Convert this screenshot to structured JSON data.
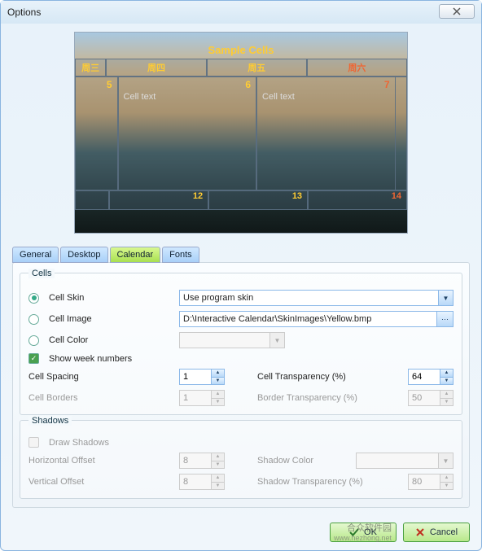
{
  "window": {
    "title": "Options"
  },
  "preview": {
    "title": "Sample Cells",
    "header_days": [
      "周三",
      "周四",
      "周五",
      "周六"
    ],
    "body_cells": [
      {
        "num": "5",
        "text": ""
      },
      {
        "num": "6",
        "text": "Cell text"
      },
      {
        "num": "7",
        "text": "Cell text"
      }
    ],
    "foot_nums": [
      "12",
      "13",
      "14"
    ]
  },
  "tabs": [
    {
      "label": "General"
    },
    {
      "label": "Desktop"
    },
    {
      "label": "Calendar"
    },
    {
      "label": "Fonts"
    }
  ],
  "cells_group": {
    "legend": "Cells",
    "cell_skin_label": "Cell Skin",
    "cell_skin_value": "Use program skin",
    "cell_image_label": "Cell Image",
    "cell_image_path": "D:\\Interactive Calendar\\SkinImages\\Yellow.bmp",
    "cell_color_label": "Cell Color",
    "show_week_label": "Show week numbers",
    "cell_spacing_label": "Cell Spacing",
    "cell_spacing_value": "1",
    "cell_trans_label": "Cell Transparency (%)",
    "cell_trans_value": "64",
    "cell_borders_label": "Cell Borders",
    "cell_borders_value": "1",
    "border_trans_label": "Border Transparency (%)",
    "border_trans_value": "50"
  },
  "shadows_group": {
    "legend": "Shadows",
    "draw_shadows_label": "Draw Shadows",
    "hoffset_label": "Horizontal Offset",
    "hoffset_value": "8",
    "voffset_label": "Vertical Offset",
    "voffset_value": "8",
    "shadow_color_label": "Shadow Color",
    "shadow_trans_label": "Shadow Transparency (%)",
    "shadow_trans_value": "80"
  },
  "buttons": {
    "ok": "OK",
    "cancel": "Cancel"
  },
  "watermark": {
    "line1": "合众软件园",
    "line2": "www.hezhong.net"
  }
}
